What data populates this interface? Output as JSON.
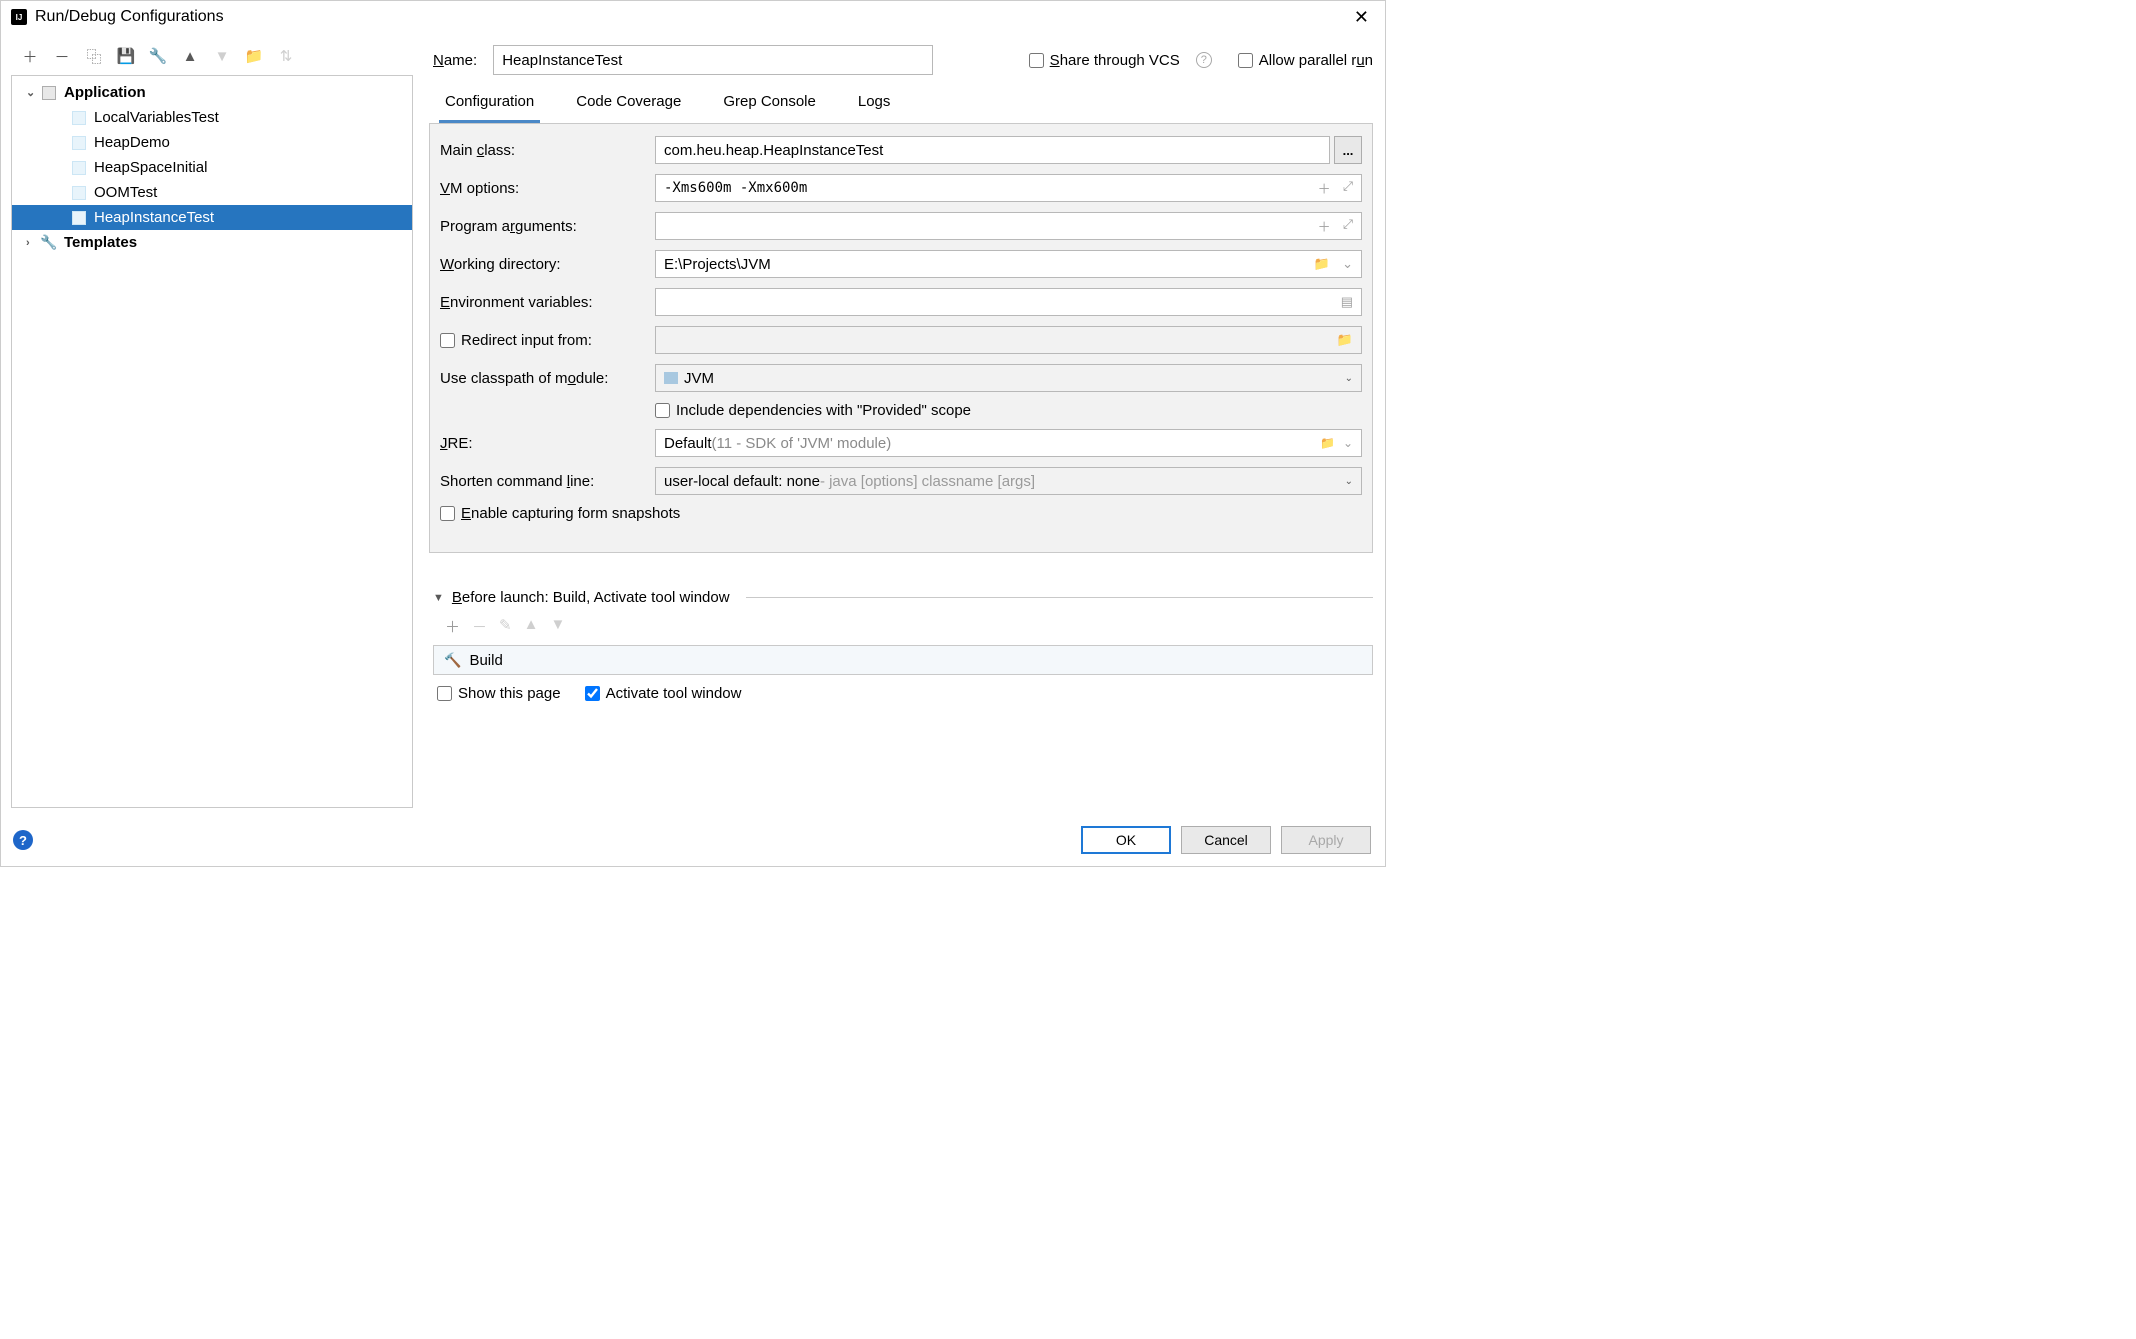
{
  "title": "Run/Debug Configurations",
  "tree": {
    "application": "Application",
    "items": [
      "LocalVariablesTest",
      "HeapDemo",
      "HeapSpaceInitial",
      "OOMTest",
      "HeapInstanceTest"
    ],
    "templates": "Templates"
  },
  "name_label": "Name:",
  "name_value": "HeapInstanceTest",
  "share_vcs": "Share through VCS",
  "allow_parallel": "Allow parallel run",
  "tabs": [
    "Configuration",
    "Code Coverage",
    "Grep Console",
    "Logs"
  ],
  "form": {
    "main_class_label": "Main class:",
    "main_class_value": "com.heu.heap.HeapInstanceTest",
    "vm_label": "VM options:",
    "vm_value": "-Xms600m -Xmx600m",
    "args_label": "Program arguments:",
    "args_value": "",
    "wd_label": "Working directory:",
    "wd_value": "E:\\Projects\\JVM",
    "env_label": "Environment variables:",
    "env_value": "",
    "redirect_label": "Redirect input from:",
    "classpath_label": "Use classpath of module:",
    "classpath_value": "JVM",
    "include_provided": "Include dependencies with \"Provided\" scope",
    "jre_label": "JRE:",
    "jre_value": "Default",
    "jre_hint": " (11 - SDK of 'JVM' module)",
    "shorten_label": "Shorten command line:",
    "shorten_value": "user-local default: none",
    "shorten_hint": " - java [options] classname [args]",
    "capture_snapshots": "Enable capturing form snapshots"
  },
  "before_launch": {
    "header": "Before launch: Build, Activate tool window",
    "build": "Build",
    "show_page": "Show this page",
    "activate_window": "Activate tool window"
  },
  "buttons": {
    "ok": "OK",
    "cancel": "Cancel",
    "apply": "Apply"
  }
}
